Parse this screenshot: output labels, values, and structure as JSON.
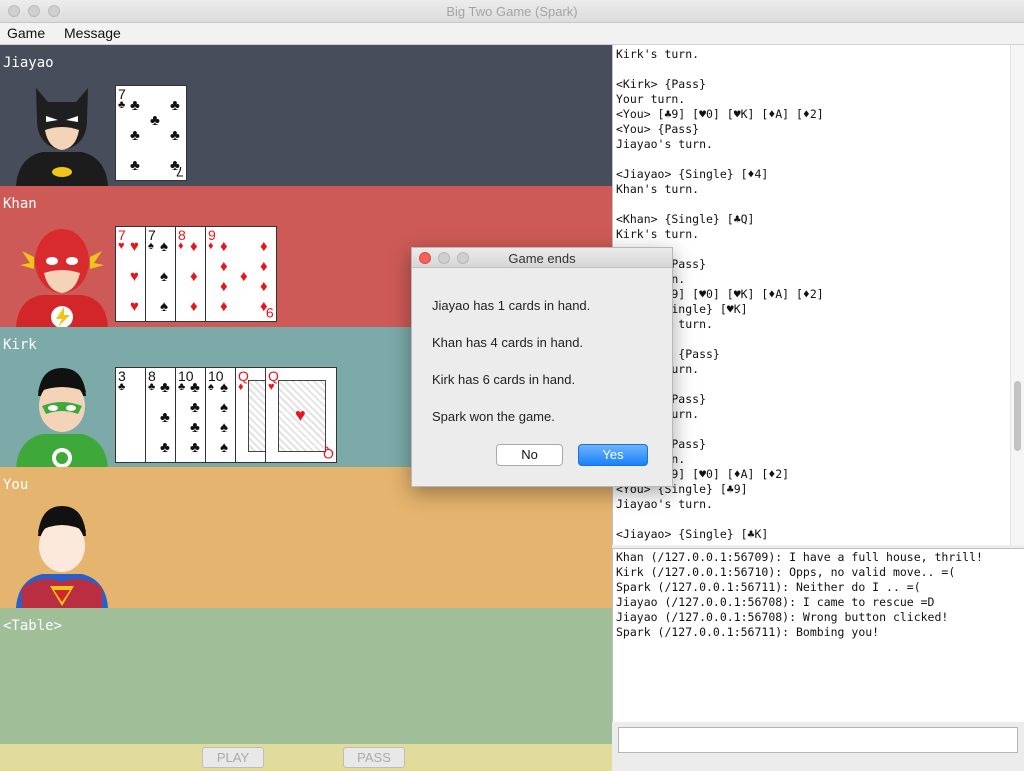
{
  "window": {
    "title": "Big Two Game (Spark)"
  },
  "menu": {
    "game": "Game",
    "message": "Message"
  },
  "players": [
    {
      "name": "Jiayao",
      "bg": "#474d5b",
      "text_color": "#ffffff",
      "avatar": "batman-icon",
      "cards": [
        {
          "rank": "7",
          "suit": "♣",
          "color": "black"
        }
      ]
    },
    {
      "name": "Khan",
      "bg": "#cd5a57",
      "text_color": "#ffffff",
      "avatar": "flash-icon",
      "cards": [
        {
          "rank": "7",
          "suit": "♥",
          "color": "red"
        },
        {
          "rank": "7",
          "suit": "♠",
          "color": "black"
        },
        {
          "rank": "8",
          "suit": "♦",
          "color": "red"
        },
        {
          "rank": "9",
          "suit": "♦",
          "color": "red"
        }
      ]
    },
    {
      "name": "Kirk",
      "bg": "#7caaa8",
      "text_color": "#ffffff",
      "avatar": "green-lantern-icon",
      "cards": [
        {
          "rank": "3",
          "suit": "♣",
          "color": "black"
        },
        {
          "rank": "8",
          "suit": "♣",
          "color": "black"
        },
        {
          "rank": "10",
          "suit": "♣",
          "color": "black"
        },
        {
          "rank": "10",
          "suit": "♠",
          "color": "black"
        },
        {
          "rank": "Q",
          "suit": "♦",
          "color": "red"
        },
        {
          "rank": "Q",
          "suit": "♥",
          "color": "red"
        }
      ]
    },
    {
      "name": "You",
      "bg": "#e5b46e",
      "text_color": "#ffffff",
      "avatar": "superman-icon",
      "cards": []
    }
  ],
  "table": {
    "label": "<Table>"
  },
  "buttons": {
    "play": "PLAY",
    "pass": "PASS"
  },
  "log_lines": [
    "Kirk's turn.",
    "",
    "<Kirk> {Pass}",
    "Your turn.",
    "<You> [♣9] [♥0] [♥K] [♦A] [♦2]",
    "<You> {Pass}",
    "Jiayao's turn.",
    "",
    "<Jiayao> {Single} [♦4]",
    "Khan's turn.",
    "",
    "<Khan> {Single} [♣Q]",
    "Kirk's turn.",
    "",
    "<Kirk> {Pass}",
    "Your turn.",
    "<You> [♣9] [♥0] [♥K] [♦A] [♦2]",
    "<You> {Single} [♥K]",
    "Jiayao's turn.",
    "",
    "<Jiayao> {Pass}",
    "Khan's turn.",
    "",
    "<Khan> {Pass}",
    "Kirk's turn.",
    "",
    "<Kirk> {Pass}",
    "Your turn.",
    "<You> [♣9] [♥0] [♦A] [♦2]",
    "<You> {Single} [♣9]",
    "Jiayao's turn.",
    "",
    "<Jiayao> {Single} [♣K]"
  ],
  "chat_lines": [
    "Khan (/127.0.0.1:56709): I have a full house, thrill!",
    "Kirk (/127.0.0.1:56710): Opps, no valid move.. =(",
    "Spark (/127.0.0.1:56711): Neither do I .. =(",
    "Jiayao (/127.0.0.1:56708): I came to rescue =D",
    "Jiayao (/127.0.0.1:56708): Wrong button clicked!",
    "Spark (/127.0.0.1:56711): Bombing you!"
  ],
  "chat_input": {
    "value": ""
  },
  "dialog": {
    "title": "Game ends",
    "messages": [
      "Jiayao has 1 cards in hand.",
      "Khan has 4 cards in hand.",
      "Kirk has 6 cards in hand.",
      "Spark won the game."
    ],
    "no_label": "No",
    "yes_label": "Yes"
  }
}
